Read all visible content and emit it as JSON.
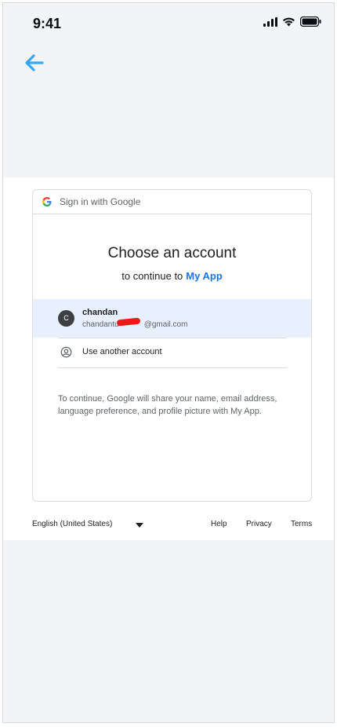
{
  "status_bar": {
    "time": "9:41"
  },
  "nav": {
    "back_icon": "arrow-left-icon",
    "back_color": "#35a7f0"
  },
  "card": {
    "header_title": "Sign in with Google",
    "heading": "Choose an account",
    "subheading_prefix": "to continue to",
    "app_name": "My App",
    "account": {
      "avatar_letter": "C",
      "name": "chandan",
      "email_prefix": "chandantu",
      "email_suffix": "@gmail.com"
    },
    "use_another": "Use another account",
    "notice": "To continue, Google will share your name, email address, language preference, and profile picture with My App."
  },
  "footer": {
    "language": "English (United States)",
    "help": "Help",
    "privacy": "Privacy",
    "terms": "Terms"
  },
  "colors": {
    "accent_link": "#1a73e8",
    "selected_row": "#e8f0fe",
    "page_bg": "#f3f4f6"
  }
}
